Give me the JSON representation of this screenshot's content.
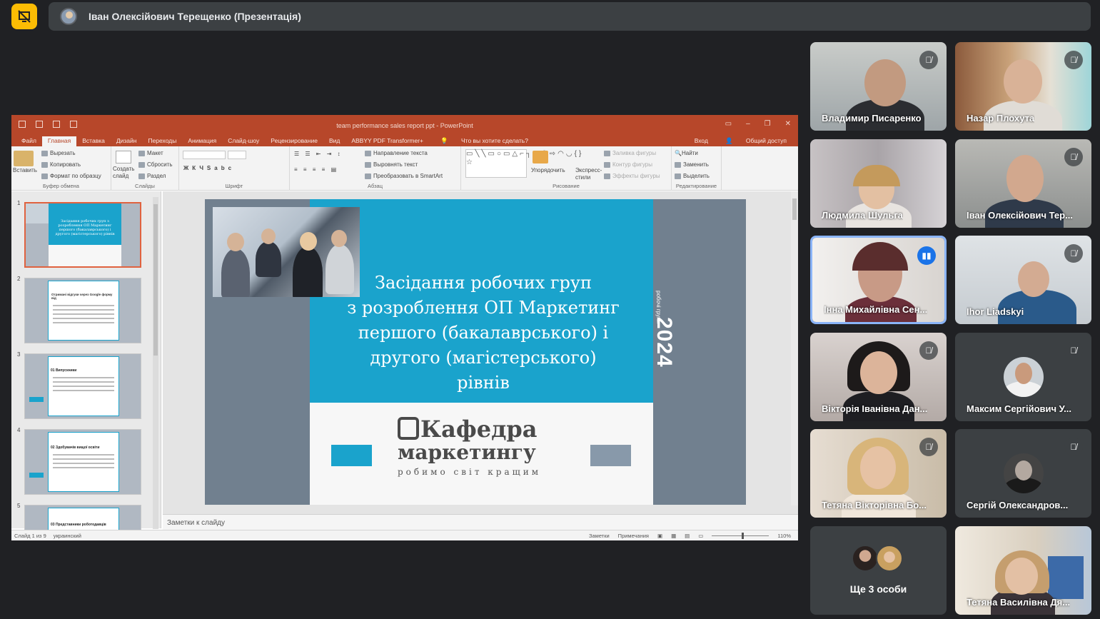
{
  "header": {
    "presenter_title": "Іван Олексійович Терещенко (Презентація)",
    "stop_presenting_icon": "present-off-icon"
  },
  "powerpoint": {
    "window_title": "team performance sales report ppt - PowerPoint",
    "tabs": [
      "Файл",
      "Главная",
      "Вставка",
      "Дизайн",
      "Переходы",
      "Анимация",
      "Слайд-шоу",
      "Рецензирование",
      "Вид",
      "ABBYY PDF Transformer+"
    ],
    "active_tab": "Главная",
    "tell_me": "Что вы хотите сделать?",
    "signin": "Вход",
    "share": "Общий доступ",
    "ribbon": {
      "paste": "Вставить",
      "cut": "Вырезать",
      "copy": "Копировать",
      "format_painter": "Формат по образцу",
      "clipboard_group": "Буфер обмена",
      "new_slide": "Создать слайд",
      "layout": "Макет",
      "reset": "Сбросить",
      "section": "Раздел",
      "slides_group": "Слайды",
      "font_group": "Шрифт",
      "text_direction": "Направление текста",
      "align_text": "Выровнять текст",
      "smartart": "Преобразовать в SmartArt",
      "paragraph_group": "Абзац",
      "arrange": "Упорядочить",
      "quick_styles": "Экспресс-стили",
      "shape_fill": "Заливка фигуры",
      "shape_outline": "Контур фигуры",
      "shape_effects": "Эффекты фигуры",
      "drawing_group": "Рисование",
      "find": "Найти",
      "replace": "Заменить",
      "select": "Выделить",
      "editing_group": "Редактирование"
    },
    "thumbnails": [
      {
        "num": "1",
        "title": "Засідання робочих груп з розроблення ОП Маркетинг першого (бакалаврського) і другого (магістерського) рівнів"
      },
      {
        "num": "2",
        "title": "Отримані відгуки через Google форму від"
      },
      {
        "num": "3",
        "title": "01 Випускники"
      },
      {
        "num": "4",
        "title": "02 Здобувачів вищої освіти"
      },
      {
        "num": "5",
        "title": "03 Представники роботодавців"
      }
    ],
    "slide": {
      "title_lines": [
        "Засідання робочих груп",
        "з розроблення ОП Маркетинг",
        "першого (бакалаврського) і",
        "другого (магістерського)",
        "рівнів"
      ],
      "year": "2024",
      "year_caption": "робочі групи",
      "logo_line1": "Кафедра",
      "logo_line2": "маркетингу",
      "logo_tagline": "робимо світ кращим"
    },
    "notes_placeholder": "Заметки к слайду",
    "status": {
      "slide_counter": "Слайд 1 из 9",
      "language": "украинский",
      "notes": "Заметки",
      "comments": "Примечания",
      "zoom": "110%"
    }
  },
  "participants": [
    {
      "name": "Владимир Писаренко",
      "muted": true
    },
    {
      "name": "Назар Плохута",
      "muted": true
    },
    {
      "name": "Людмила Шульга",
      "muted": false
    },
    {
      "name": "Іван Олексійович Тер...",
      "muted": true
    },
    {
      "name": "Інна Михайлівна Сен...",
      "speaking": true
    },
    {
      "name": "Ihor Liadskyi",
      "muted": true
    },
    {
      "name": "Вікторія Іванівна Дан...",
      "muted": true
    },
    {
      "name": "Максим Сергійович У...",
      "muted": true
    },
    {
      "name": "Тетяна Вікторівна Бо...",
      "muted": true
    },
    {
      "name": "Сергій Олександров...",
      "muted": true
    },
    {
      "name": "Тетяна Василівна Дя...",
      "muted": false
    }
  ],
  "more_participants": "Ще 3 особи",
  "colors": {
    "accent_teal": "#1aa3cc",
    "ppt_red": "#b7472a",
    "meet_bg": "#202124",
    "tile_bg": "#3c4043",
    "highlight": "#fbbc04"
  }
}
